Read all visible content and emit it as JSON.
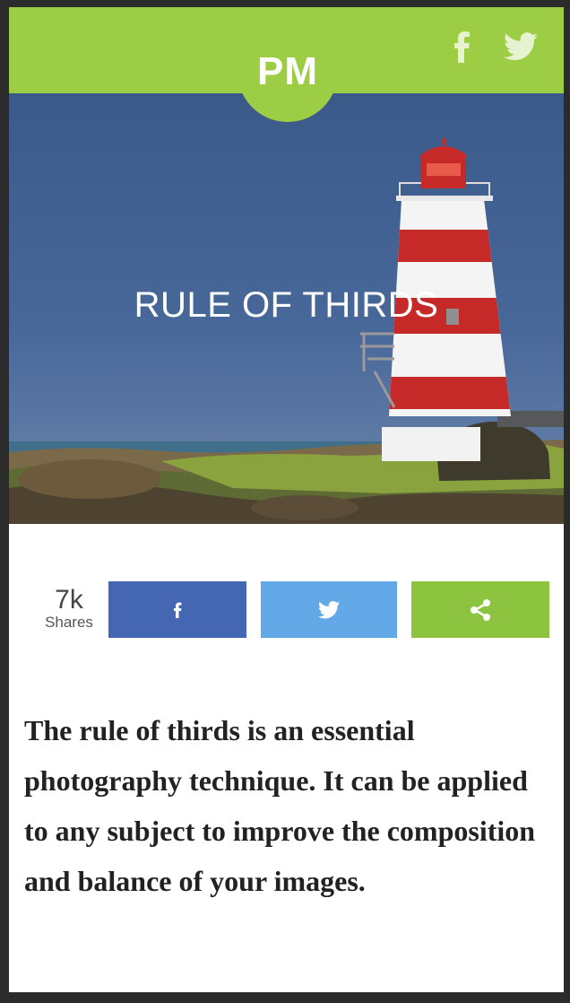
{
  "header": {
    "logo_text": "PM",
    "brand_color": "#9dcc45",
    "social_icons": [
      "facebook-icon",
      "twitter-icon"
    ]
  },
  "hero": {
    "title": "RULE OF THIRDS",
    "image": "lighthouse-on-rocky-shore"
  },
  "share": {
    "count": "7k",
    "count_label": "Shares",
    "buttons": [
      {
        "icon": "facebook-icon",
        "color": "#4466b3"
      },
      {
        "icon": "twitter-icon",
        "color": "#63a9e8"
      },
      {
        "icon": "share-icon",
        "color": "#8cc440"
      }
    ]
  },
  "article": {
    "text": "The rule of thirds is an essential photography technique. It can be applied to any subject to improve the composition and balance of your images."
  }
}
